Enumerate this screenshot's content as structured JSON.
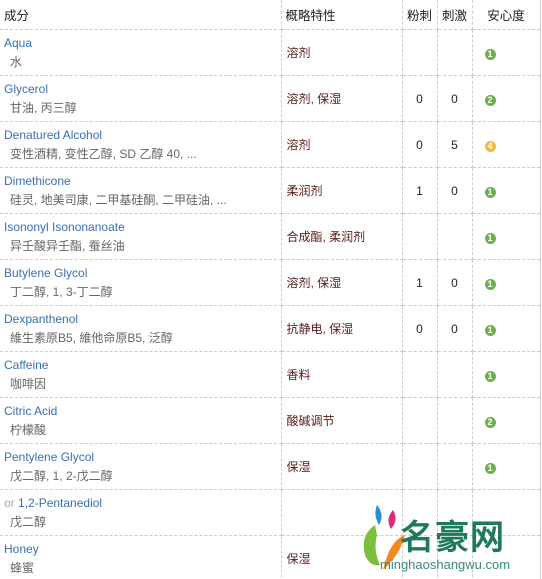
{
  "headers": {
    "ingredient": "成分",
    "function": "概略特性",
    "acne": "粉刺",
    "irritation": "刺激",
    "safety": "安心度"
  },
  "colors": {
    "safe_green": "#6ab04c",
    "warn_yellow": "#f5b83d",
    "link": "#3a6fb5"
  },
  "rows": [
    {
      "prefix": "",
      "en": "Aqua",
      "cn": "水",
      "func": "溶剂",
      "acne": "",
      "irr": "",
      "safety": "1"
    },
    {
      "prefix": "",
      "en": "Glycerol",
      "cn": "甘油, 丙三醇",
      "func": "溶剂, 保湿",
      "acne": "0",
      "irr": "0",
      "safety": "2"
    },
    {
      "prefix": "",
      "en": "Denatured Alcohol",
      "cn": "变性酒精, 变性乙醇, SD 乙醇 40, ...",
      "func": "溶剂",
      "acne": "0",
      "irr": "5",
      "safety": "4"
    },
    {
      "prefix": "",
      "en": "Dimethicone",
      "cn": "硅灵, 地美司康, 二甲基硅酮, 二甲硅油, ...",
      "func": "柔润剂",
      "acne": "1",
      "irr": "0",
      "safety": "1"
    },
    {
      "prefix": "",
      "en": "Isononyl Isononanoate",
      "cn": "异壬酸异壬酯, 蚕丝油",
      "func": "合成酯, 柔润剂",
      "acne": "",
      "irr": "",
      "safety": "1"
    },
    {
      "prefix": "",
      "en": "Butylene Glycol",
      "cn": "丁二醇, 1, 3-丁二醇",
      "func": "溶剂, 保湿",
      "acne": "1",
      "irr": "0",
      "safety": "1"
    },
    {
      "prefix": "",
      "en": "Dexpanthenol",
      "cn": "維生素原B5, 維他命原B5, 泛醇",
      "func": "抗静电, 保湿",
      "acne": "0",
      "irr": "0",
      "safety": "1"
    },
    {
      "prefix": "",
      "en": "Caffeine",
      "cn": "咖啡因",
      "func": "香料",
      "acne": "",
      "irr": "",
      "safety": "1"
    },
    {
      "prefix": "",
      "en": "Citric Acid",
      "cn": "柠檬酸",
      "func": "酸碱调节",
      "acne": "",
      "irr": "",
      "safety": "2"
    },
    {
      "prefix": "",
      "en": "Pentylene Glycol",
      "cn": "戊二醇, 1, 2-戊二醇",
      "func": "保湿",
      "acne": "",
      "irr": "",
      "safety": "1"
    },
    {
      "prefix": "or ",
      "en": "1,2-Pentanediol",
      "cn": "戊二醇",
      "func": "",
      "acne": "",
      "irr": "",
      "safety": ""
    },
    {
      "prefix": "",
      "en": "Honey",
      "cn": "蜂蜜",
      "func": "保湿",
      "acne": "",
      "irr": "",
      "safety": ""
    }
  ],
  "watermark": {
    "title": "名豪网",
    "url": "minghaoshangwu.com"
  }
}
